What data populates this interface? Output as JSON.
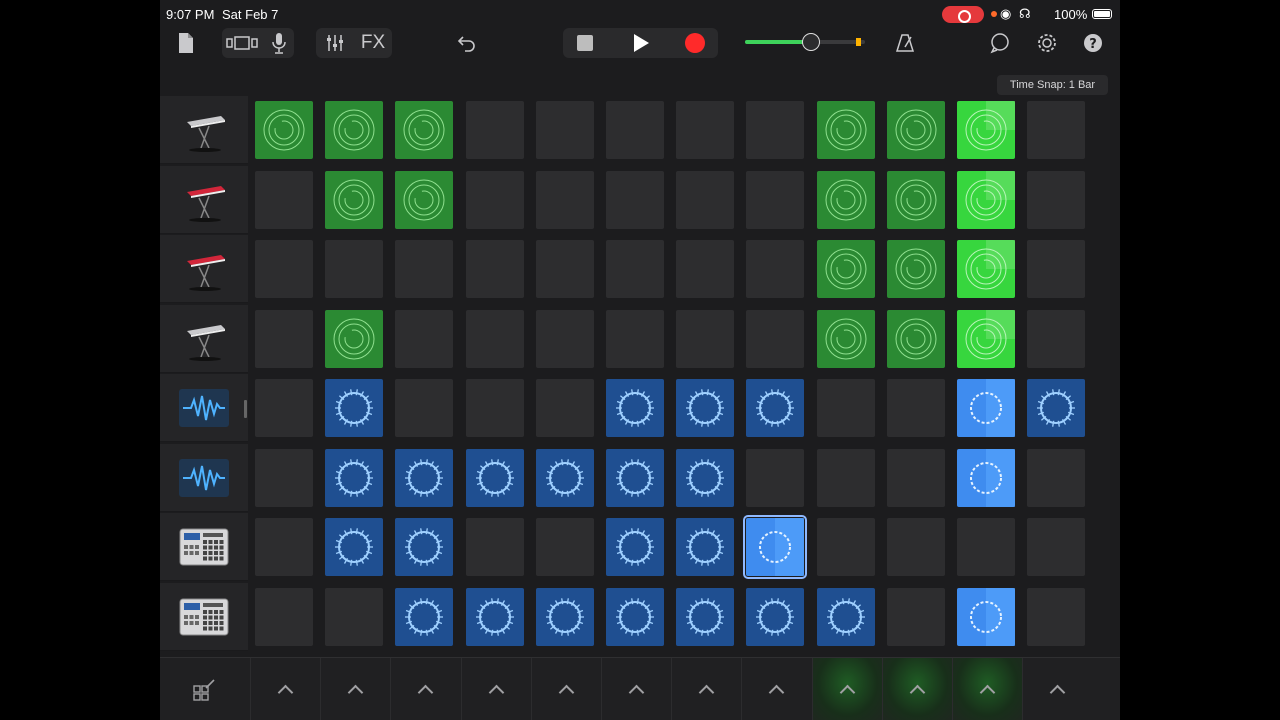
{
  "status_bar": {
    "time": "9:07 PM",
    "date": "Sat Feb 7",
    "battery": "100%"
  },
  "toolbar": {
    "fx_label": "FX",
    "volume_level": 0.55,
    "buttons": [
      "document-icon",
      "view-toggle-icon",
      "microphone-icon",
      "mixer-icon",
      "fx-button",
      "undo-icon",
      "stop-button",
      "play-button",
      "record-button",
      "metronome-icon",
      "loop-browser-icon",
      "settings-icon",
      "help-icon"
    ]
  },
  "time_snap": "Time Snap: 1 Bar",
  "tracks": [
    {
      "instrument": "keyboard-silver"
    },
    {
      "instrument": "keyboard-red"
    },
    {
      "instrument": "keyboard-red"
    },
    {
      "instrument": "keyboard-silver"
    },
    {
      "instrument": "audio-waveform"
    },
    {
      "instrument": "audio-waveform"
    },
    {
      "instrument": "drum-machine"
    },
    {
      "instrument": "drum-machine"
    }
  ],
  "grid": [
    [
      "g-dark",
      "g-dark",
      "g-dark",
      "",
      "",
      "",
      "",
      "",
      "g-dark",
      "g-dark",
      "g-bright",
      ""
    ],
    [
      "",
      "g-dark",
      "g-dark",
      "",
      "",
      "",
      "",
      "",
      "g-dark",
      "g-dark",
      "g-bright",
      ""
    ],
    [
      "",
      "",
      "",
      "",
      "",
      "",
      "",
      "",
      "g-dark",
      "g-dark",
      "g-bright",
      ""
    ],
    [
      "",
      "g-dark",
      "",
      "",
      "",
      "",
      "",
      "",
      "g-dark",
      "g-dark",
      "g-bright",
      ""
    ],
    [
      "",
      "b-dark",
      "",
      "",
      "",
      "b-dark",
      "b-dark",
      "b-dark",
      "",
      "",
      "b-bright",
      "b-dark"
    ],
    [
      "",
      "b-dark",
      "b-dark",
      "b-dark",
      "b-dark",
      "b-dark",
      "b-dark",
      "",
      "",
      "",
      "b-bright",
      ""
    ],
    [
      "",
      "b-dark",
      "b-dark",
      "",
      "",
      "b-dark",
      "b-dark",
      "b-sel",
      "",
      "",
      "",
      ""
    ],
    [
      "",
      "",
      "b-dark",
      "b-dark",
      "b-dark",
      "b-dark",
      "b-dark",
      "b-dark",
      "b-dark",
      "",
      "b-bright",
      ""
    ]
  ],
  "column_triggers_active": [
    false,
    false,
    false,
    false,
    false,
    false,
    false,
    false,
    true,
    true,
    true,
    false
  ],
  "colors": {
    "green_cell": "#2b8a33",
    "green_bright": "#37d63e",
    "blue_cell": "#1f4f91",
    "blue_bright": "#3f8cef",
    "record": "#ff2a2a"
  }
}
